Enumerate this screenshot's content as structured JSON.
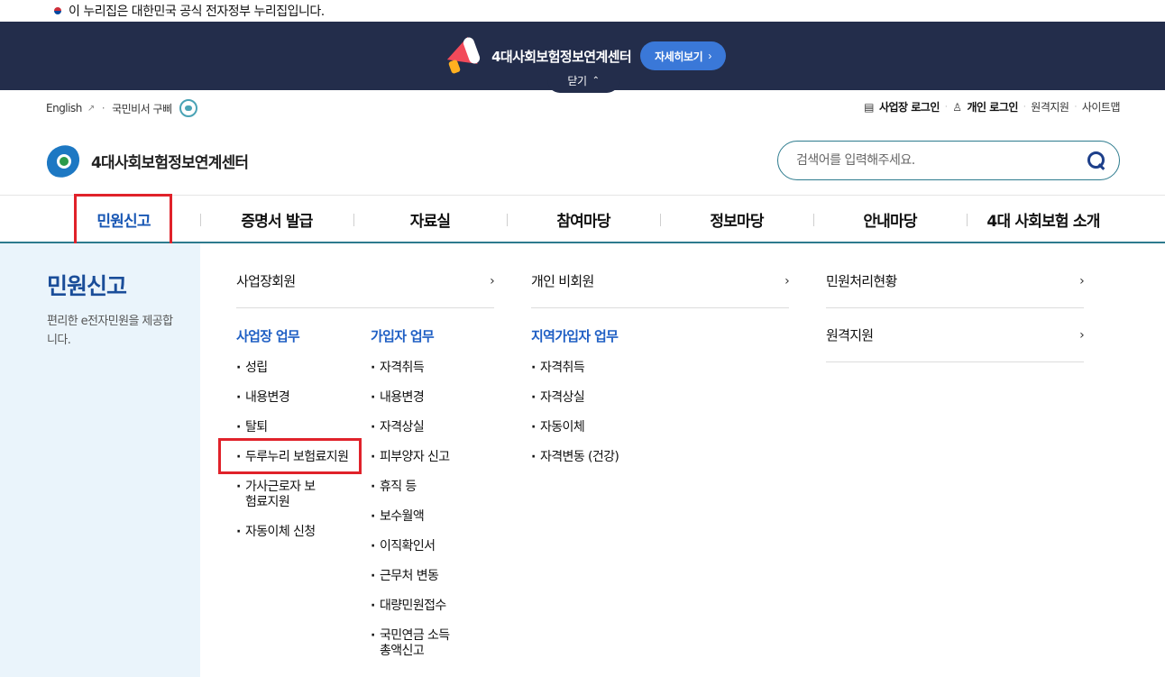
{
  "gov_notice": "이 누리집은 대한민국 공식 전자정부 누리집입니다.",
  "banner": {
    "title": "4대사회보험정보연계센터",
    "more_label": "자세히보기",
    "more_chevron": "›",
    "close_label": "닫기",
    "close_chevron": "⌃"
  },
  "utility": {
    "english": "English",
    "chatbot": "국민비서 구삐",
    "biz_login": "사업장 로그인",
    "personal_login": "개인 로그인",
    "remote_support": "원격지원",
    "sitemap": "사이트맵"
  },
  "logo": {
    "name": "4대사회보험정보연계센터"
  },
  "search": {
    "placeholder": "검색어를 입력해주세요."
  },
  "gnb": [
    {
      "label": "민원신고"
    },
    {
      "label": "증명서 발급"
    },
    {
      "label": "자료실"
    },
    {
      "label": "참여마당"
    },
    {
      "label": "정보마당"
    },
    {
      "label": "안내마당"
    },
    {
      "label": "4대 사회보험 소개"
    }
  ],
  "mega": {
    "title": "민원신고",
    "desc": "편리한 e전자민원을 제공합니다.",
    "links": {
      "business_member": "사업장회원",
      "personal_nonmember": "개인 비회원",
      "status": "민원처리현황",
      "remote": "원격지원",
      "chevron": "›"
    },
    "business_work": {
      "title": "사업장 업무",
      "items": [
        "성립",
        "내용변경",
        "탈퇴",
        "두루누리 보험료지원",
        "가사근로자 보험료지원",
        "자동이체 신청"
      ]
    },
    "subscriber_work": {
      "title": "가입자 업무",
      "items": [
        "자격취득",
        "내용변경",
        "자격상실",
        "피부양자 신고",
        "휴직 등",
        "보수월액",
        "이직확인서",
        "근무처 변동",
        "대량민원접수",
        "국민연금 소득총액신고"
      ]
    },
    "regional_work": {
      "title": "지역가입자 업무",
      "items": [
        "자격취득",
        "자격상실",
        "자동이체",
        "자격변동 (건강)"
      ]
    }
  },
  "colors": {
    "banner_bg": "#232d4b",
    "accent_blue": "#1857b4",
    "highlight_red": "#e0222a",
    "side_bg": "#eaf4fb"
  }
}
